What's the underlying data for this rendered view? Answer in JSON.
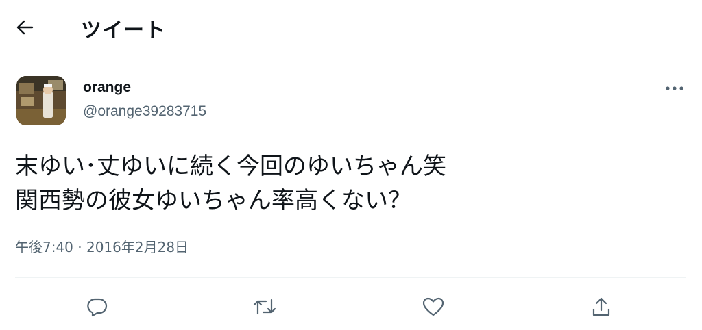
{
  "header": {
    "title": "ツイート",
    "back_icon": "back-arrow-icon"
  },
  "author": {
    "display_name": "orange",
    "handle": "@orange39283715"
  },
  "tweet": {
    "lines": [
      "末ゆい･丈ゆいに続く今回のゆいちゃん笑",
      "関西勢の彼女ゆいちゃん率高くない？"
    ],
    "timestamp": "午後7:40 · 2016年2月28日"
  },
  "actions": [
    "reply-icon",
    "retweet-icon",
    "like-icon",
    "share-icon"
  ],
  "colors": {
    "text": "#0f1419",
    "secondary": "#536471",
    "divider": "#eff3f4"
  }
}
